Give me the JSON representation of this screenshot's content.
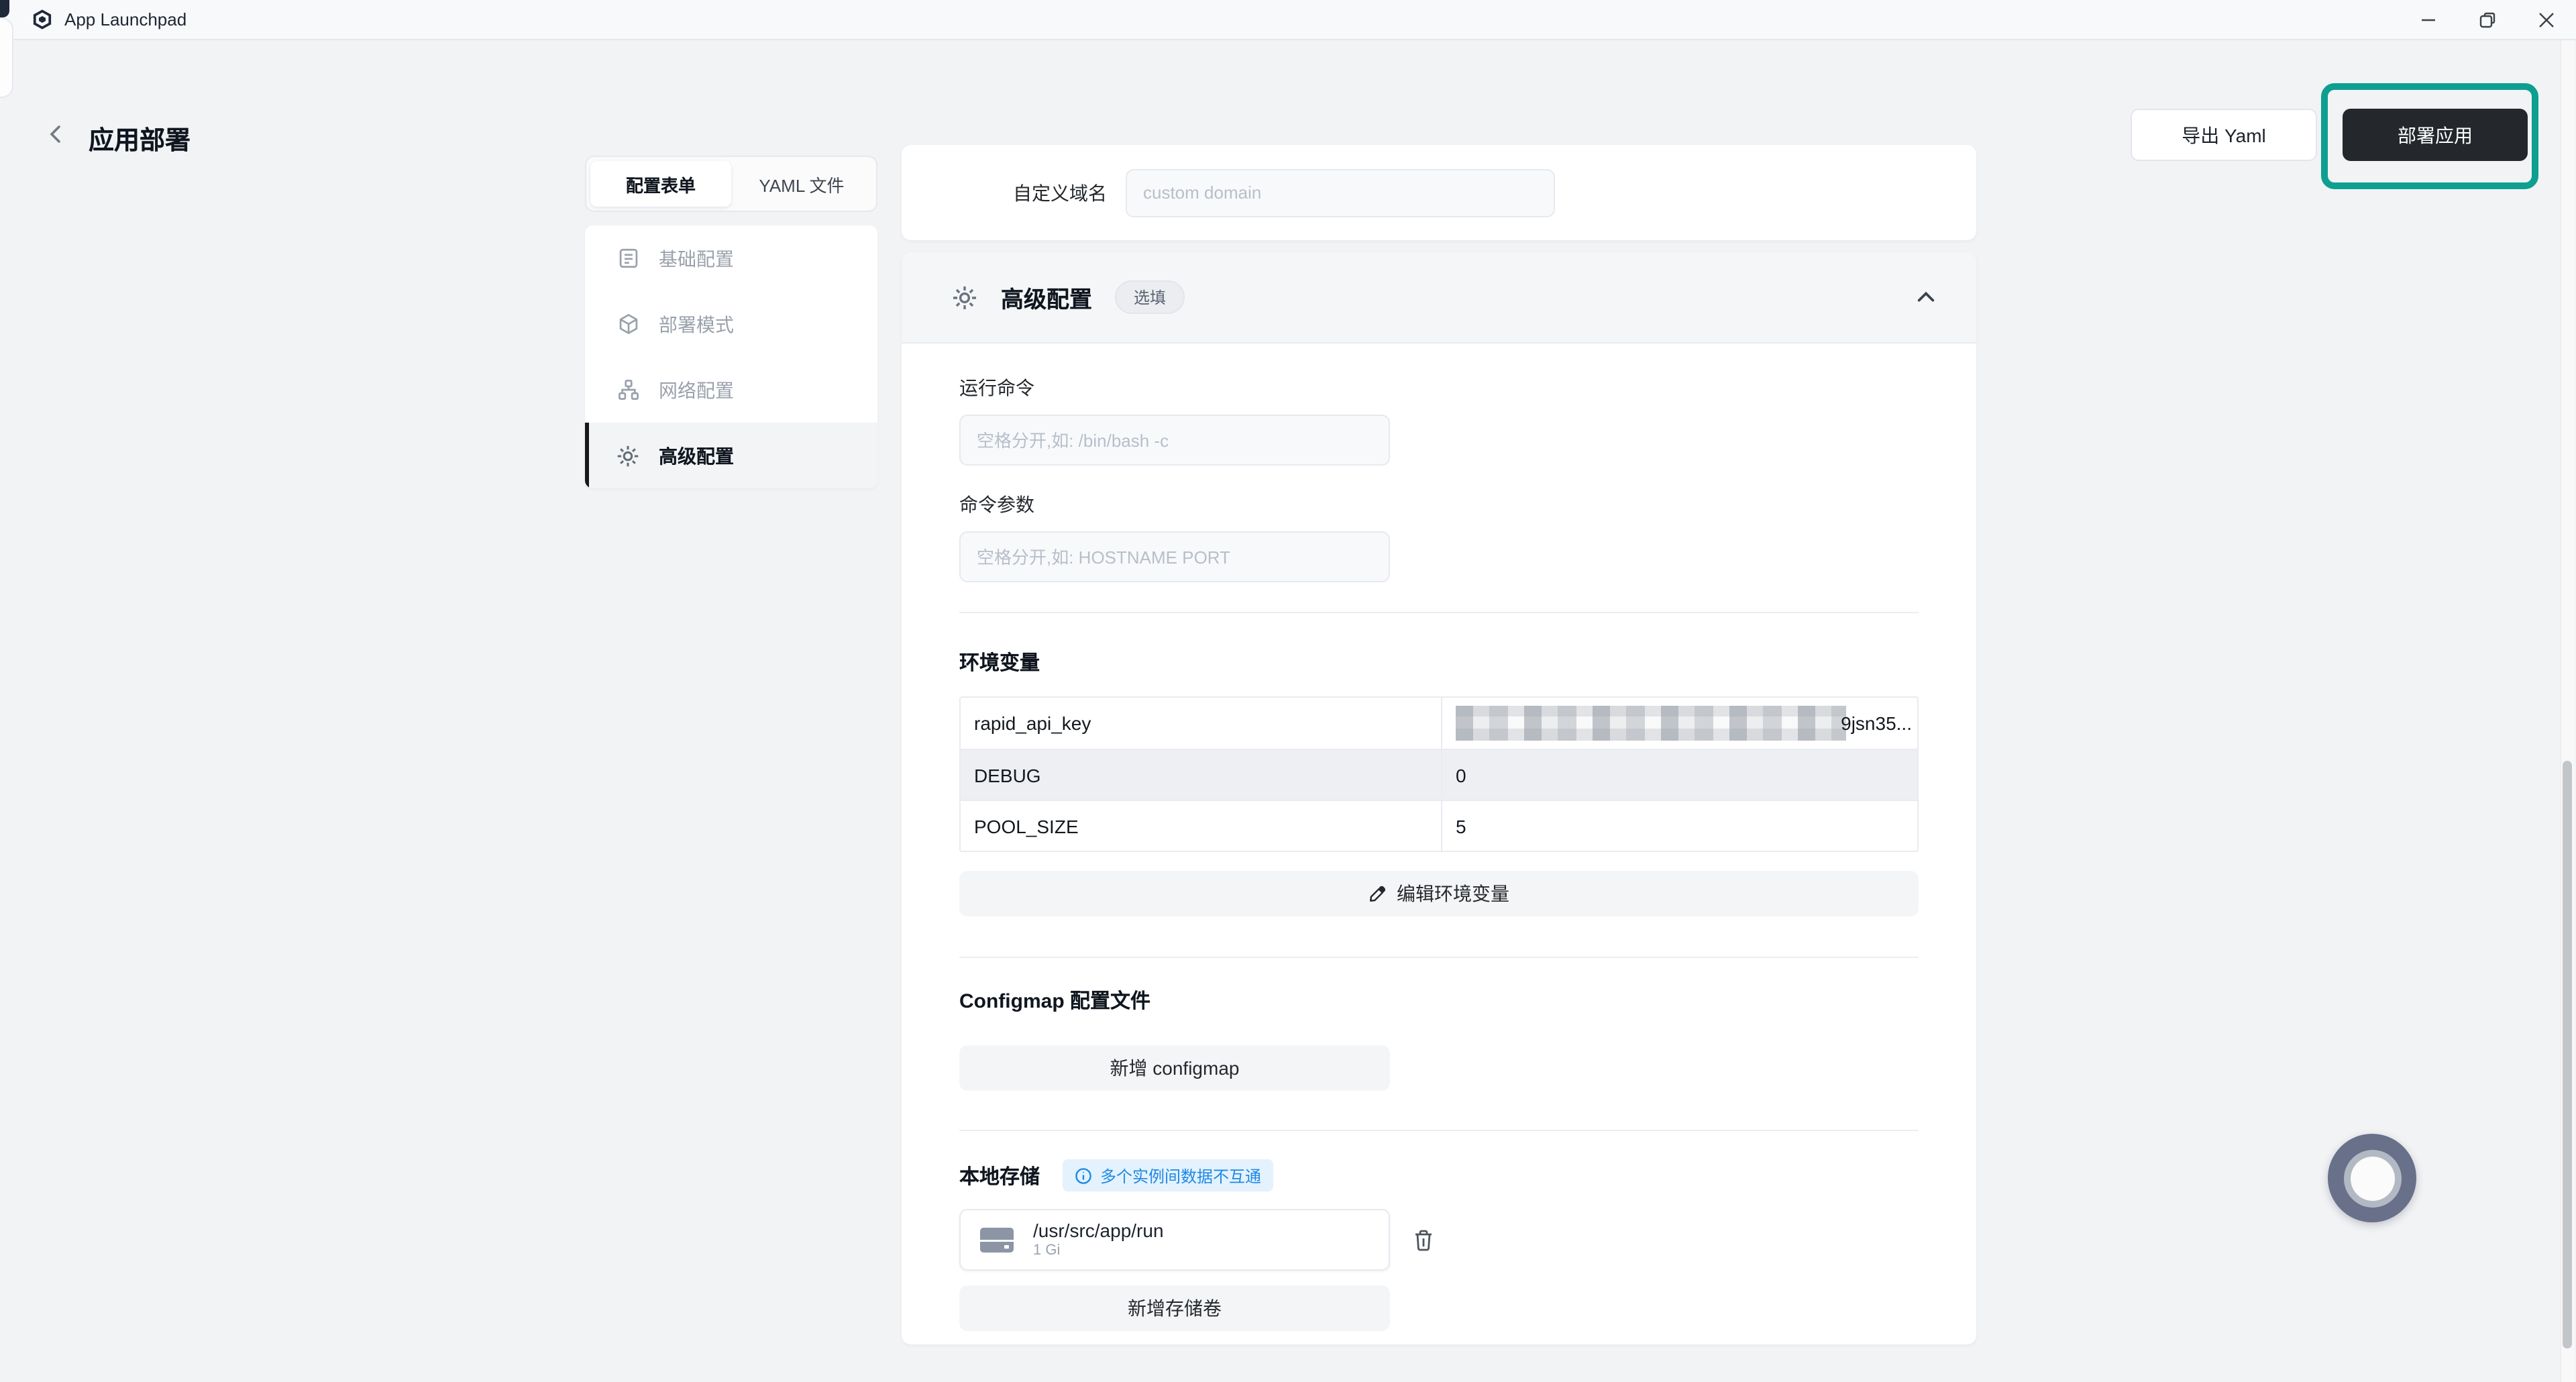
{
  "titlebar": {
    "app_name": "App Launchpad"
  },
  "window_controls": {
    "minimize": "minimize",
    "restore": "restore",
    "close": "close"
  },
  "header": {
    "title": "应用部署",
    "export_button": "导出 Yaml",
    "deploy_button": "部署应用"
  },
  "sidebar": {
    "tabs": [
      {
        "label": "配置表单",
        "active": true
      },
      {
        "label": "YAML 文件",
        "active": false
      }
    ],
    "items": [
      {
        "label": "基础配置",
        "icon": "document-icon",
        "active": false
      },
      {
        "label": "部署模式",
        "icon": "cube-icon",
        "active": false
      },
      {
        "label": "网络配置",
        "icon": "network-icon",
        "active": false
      },
      {
        "label": "高级配置",
        "icon": "gear-icon",
        "active": true
      }
    ]
  },
  "form": {
    "custom_domain": {
      "label": "自定义域名",
      "placeholder": "custom domain"
    },
    "advanced": {
      "title": "高级配置",
      "badge": "选填"
    },
    "run_command": {
      "label": "运行命令",
      "placeholder": "空格分开,如: /bin/bash -c"
    },
    "cmd_params": {
      "label": "命令参数",
      "placeholder": "空格分开,如: HOSTNAME PORT"
    },
    "env": {
      "title": "环境变量",
      "rows": [
        {
          "key": "rapid_api_key",
          "value": "9jsn35...",
          "redacted": true
        },
        {
          "key": "DEBUG",
          "value": "0",
          "redacted": false
        },
        {
          "key": "POOL_SIZE",
          "value": "5",
          "redacted": false
        }
      ],
      "edit_button": "编辑环境变量"
    },
    "configmap": {
      "title": "Configmap 配置文件",
      "add_button": "新增 configmap"
    },
    "storage": {
      "title": "本地存储",
      "badge": "多个实例间数据不互通",
      "volumes": [
        {
          "path": "/usr/src/app/run",
          "size": "1 Gi"
        }
      ],
      "add_button": "新增存储卷"
    }
  },
  "colors": {
    "accent_teal": "#0e9f90",
    "dark_button": "#24282d",
    "info_blue": "#1e88e5",
    "page_bg": "#f2f3f5"
  }
}
